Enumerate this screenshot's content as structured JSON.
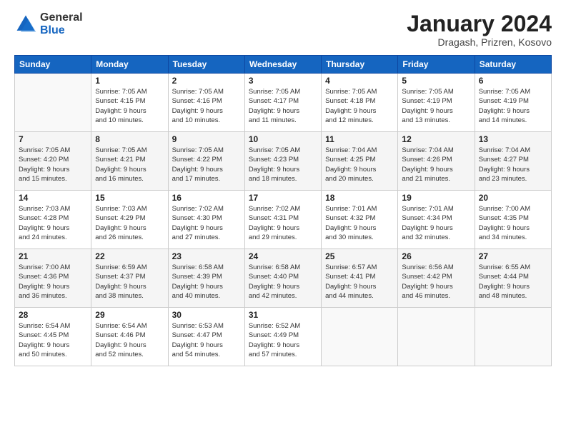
{
  "header": {
    "logo_general": "General",
    "logo_blue": "Blue",
    "title": "January 2024",
    "location": "Dragash, Prizren, Kosovo"
  },
  "days_of_week": [
    "Sunday",
    "Monday",
    "Tuesday",
    "Wednesday",
    "Thursday",
    "Friday",
    "Saturday"
  ],
  "weeks": [
    {
      "shade": false,
      "days": [
        {
          "num": "",
          "info": ""
        },
        {
          "num": "1",
          "info": "Sunrise: 7:05 AM\nSunset: 4:15 PM\nDaylight: 9 hours\nand 10 minutes."
        },
        {
          "num": "2",
          "info": "Sunrise: 7:05 AM\nSunset: 4:16 PM\nDaylight: 9 hours\nand 10 minutes."
        },
        {
          "num": "3",
          "info": "Sunrise: 7:05 AM\nSunset: 4:17 PM\nDaylight: 9 hours\nand 11 minutes."
        },
        {
          "num": "4",
          "info": "Sunrise: 7:05 AM\nSunset: 4:18 PM\nDaylight: 9 hours\nand 12 minutes."
        },
        {
          "num": "5",
          "info": "Sunrise: 7:05 AM\nSunset: 4:19 PM\nDaylight: 9 hours\nand 13 minutes."
        },
        {
          "num": "6",
          "info": "Sunrise: 7:05 AM\nSunset: 4:19 PM\nDaylight: 9 hours\nand 14 minutes."
        }
      ]
    },
    {
      "shade": true,
      "days": [
        {
          "num": "7",
          "info": "Sunrise: 7:05 AM\nSunset: 4:20 PM\nDaylight: 9 hours\nand 15 minutes."
        },
        {
          "num": "8",
          "info": "Sunrise: 7:05 AM\nSunset: 4:21 PM\nDaylight: 9 hours\nand 16 minutes."
        },
        {
          "num": "9",
          "info": "Sunrise: 7:05 AM\nSunset: 4:22 PM\nDaylight: 9 hours\nand 17 minutes."
        },
        {
          "num": "10",
          "info": "Sunrise: 7:05 AM\nSunset: 4:23 PM\nDaylight: 9 hours\nand 18 minutes."
        },
        {
          "num": "11",
          "info": "Sunrise: 7:04 AM\nSunset: 4:25 PM\nDaylight: 9 hours\nand 20 minutes."
        },
        {
          "num": "12",
          "info": "Sunrise: 7:04 AM\nSunset: 4:26 PM\nDaylight: 9 hours\nand 21 minutes."
        },
        {
          "num": "13",
          "info": "Sunrise: 7:04 AM\nSunset: 4:27 PM\nDaylight: 9 hours\nand 23 minutes."
        }
      ]
    },
    {
      "shade": false,
      "days": [
        {
          "num": "14",
          "info": "Sunrise: 7:03 AM\nSunset: 4:28 PM\nDaylight: 9 hours\nand 24 minutes."
        },
        {
          "num": "15",
          "info": "Sunrise: 7:03 AM\nSunset: 4:29 PM\nDaylight: 9 hours\nand 26 minutes."
        },
        {
          "num": "16",
          "info": "Sunrise: 7:02 AM\nSunset: 4:30 PM\nDaylight: 9 hours\nand 27 minutes."
        },
        {
          "num": "17",
          "info": "Sunrise: 7:02 AM\nSunset: 4:31 PM\nDaylight: 9 hours\nand 29 minutes."
        },
        {
          "num": "18",
          "info": "Sunrise: 7:01 AM\nSunset: 4:32 PM\nDaylight: 9 hours\nand 30 minutes."
        },
        {
          "num": "19",
          "info": "Sunrise: 7:01 AM\nSunset: 4:34 PM\nDaylight: 9 hours\nand 32 minutes."
        },
        {
          "num": "20",
          "info": "Sunrise: 7:00 AM\nSunset: 4:35 PM\nDaylight: 9 hours\nand 34 minutes."
        }
      ]
    },
    {
      "shade": true,
      "days": [
        {
          "num": "21",
          "info": "Sunrise: 7:00 AM\nSunset: 4:36 PM\nDaylight: 9 hours\nand 36 minutes."
        },
        {
          "num": "22",
          "info": "Sunrise: 6:59 AM\nSunset: 4:37 PM\nDaylight: 9 hours\nand 38 minutes."
        },
        {
          "num": "23",
          "info": "Sunrise: 6:58 AM\nSunset: 4:39 PM\nDaylight: 9 hours\nand 40 minutes."
        },
        {
          "num": "24",
          "info": "Sunrise: 6:58 AM\nSunset: 4:40 PM\nDaylight: 9 hours\nand 42 minutes."
        },
        {
          "num": "25",
          "info": "Sunrise: 6:57 AM\nSunset: 4:41 PM\nDaylight: 9 hours\nand 44 minutes."
        },
        {
          "num": "26",
          "info": "Sunrise: 6:56 AM\nSunset: 4:42 PM\nDaylight: 9 hours\nand 46 minutes."
        },
        {
          "num": "27",
          "info": "Sunrise: 6:55 AM\nSunset: 4:44 PM\nDaylight: 9 hours\nand 48 minutes."
        }
      ]
    },
    {
      "shade": false,
      "days": [
        {
          "num": "28",
          "info": "Sunrise: 6:54 AM\nSunset: 4:45 PM\nDaylight: 9 hours\nand 50 minutes."
        },
        {
          "num": "29",
          "info": "Sunrise: 6:54 AM\nSunset: 4:46 PM\nDaylight: 9 hours\nand 52 minutes."
        },
        {
          "num": "30",
          "info": "Sunrise: 6:53 AM\nSunset: 4:47 PM\nDaylight: 9 hours\nand 54 minutes."
        },
        {
          "num": "31",
          "info": "Sunrise: 6:52 AM\nSunset: 4:49 PM\nDaylight: 9 hours\nand 57 minutes."
        },
        {
          "num": "",
          "info": ""
        },
        {
          "num": "",
          "info": ""
        },
        {
          "num": "",
          "info": ""
        }
      ]
    }
  ]
}
